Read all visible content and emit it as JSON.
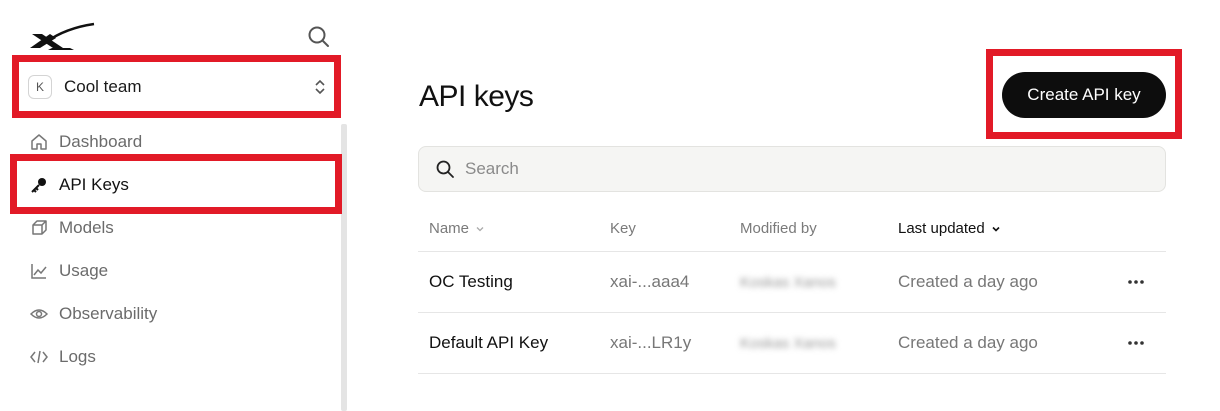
{
  "sidebar": {
    "logo_icon": "x-logo-icon",
    "team": {
      "avatar_letter": "K",
      "name": "Cool team"
    },
    "items": [
      {
        "label": "Dashboard",
        "icon": "home-icon"
      },
      {
        "label": "API Keys",
        "icon": "key-icon"
      },
      {
        "label": "Models",
        "icon": "cube-icon"
      },
      {
        "label": "Usage",
        "icon": "chart-icon"
      },
      {
        "label": "Observability",
        "icon": "eye-icon"
      },
      {
        "label": "Logs",
        "icon": "code-icon"
      }
    ],
    "active_index": 1
  },
  "main": {
    "title": "API keys",
    "create_button": "Create API key",
    "search": {
      "placeholder": "Search",
      "value": ""
    },
    "table": {
      "columns": [
        "Name",
        "Key",
        "Modified by",
        "Last updated"
      ],
      "rows": [
        {
          "name": "OC Testing",
          "key": "xai-...aaa4",
          "modified_by": "Koskas Xanos",
          "updated": "Created a day ago"
        },
        {
          "name": "Default API Key",
          "key": "xai-...LR1y",
          "modified_by": "Koskas Xanos",
          "updated": "Created a day ago"
        }
      ]
    }
  },
  "colors": {
    "highlight": "#e21a27",
    "primary_button": "#0d0d0d"
  }
}
